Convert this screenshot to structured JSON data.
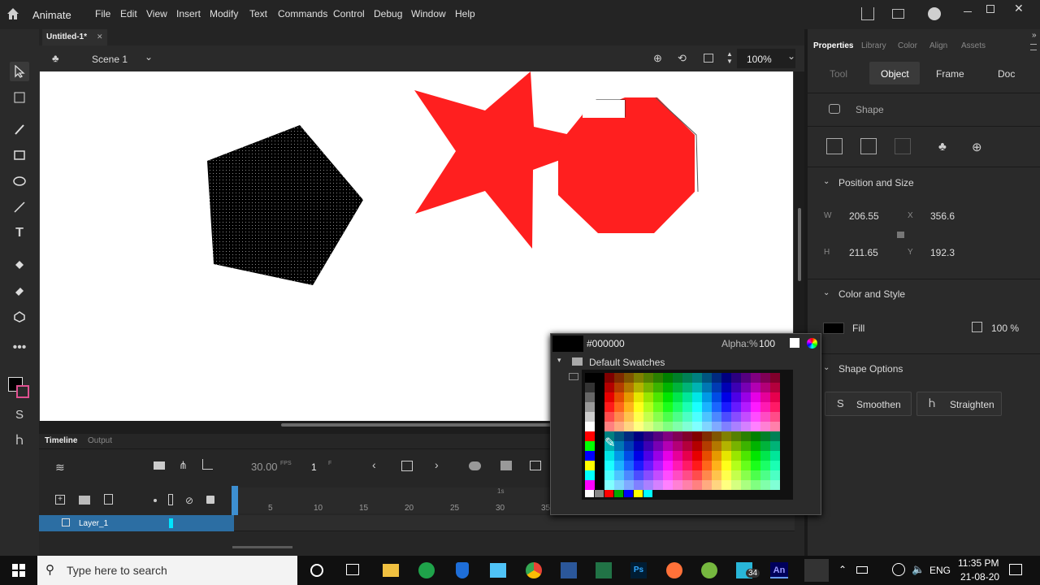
{
  "app": {
    "name": "Animate"
  },
  "menu": [
    "File",
    "Edit",
    "View",
    "Insert",
    "Modify",
    "Text",
    "Commands",
    "Control",
    "Debug",
    "Window",
    "Help"
  ],
  "document": {
    "tab_title": "Untitled-1*"
  },
  "scene": {
    "name": "Scene 1",
    "zoom": "100%"
  },
  "timeline": {
    "tabs": {
      "timeline": "Timeline",
      "output": "Output"
    },
    "fps": "30.00",
    "fps_unit": "FPS",
    "frame": "1",
    "frame_unit": "F",
    "ruler": [
      "5",
      "10",
      "15",
      "20",
      "25",
      "30",
      "35"
    ],
    "marker_1s": "1s",
    "layer_name": "Layer_1"
  },
  "props": {
    "top_tabs": [
      "Properties",
      "Library",
      "Color",
      "Align",
      "Assets"
    ],
    "sub_tabs": [
      "Tool",
      "Object",
      "Frame",
      "Doc"
    ],
    "shape_label": "Shape",
    "pos_size_title": "Position and Size",
    "w_label": "W",
    "w_value": "206.55",
    "x_label": "X",
    "x_value": "356.6",
    "h_label": "H",
    "h_value": "211.65",
    "y_label": "Y",
    "y_value": "192.3",
    "color_style_title": "Color and Style",
    "fill_label": "Fill",
    "fill_color": "#000000",
    "fill_alpha": "100 %",
    "shape_options_title": "Shape Options",
    "smoothen_label": "Smoothen",
    "straighten_label": "Straighten"
  },
  "picker": {
    "hex": "#000000",
    "alpha_label": "Alpha:%",
    "alpha_value": "100",
    "swatch_set": "Default Swatches"
  },
  "taskbar": {
    "search_placeholder": "Type here to search",
    "lang": "ENG",
    "time": "11:35 PM",
    "date": "21-08-20",
    "badge": "34"
  },
  "colors": {
    "accent": "#3d8fd1",
    "shape_red": "#ff2222",
    "stage_bg": "#ffffff"
  }
}
